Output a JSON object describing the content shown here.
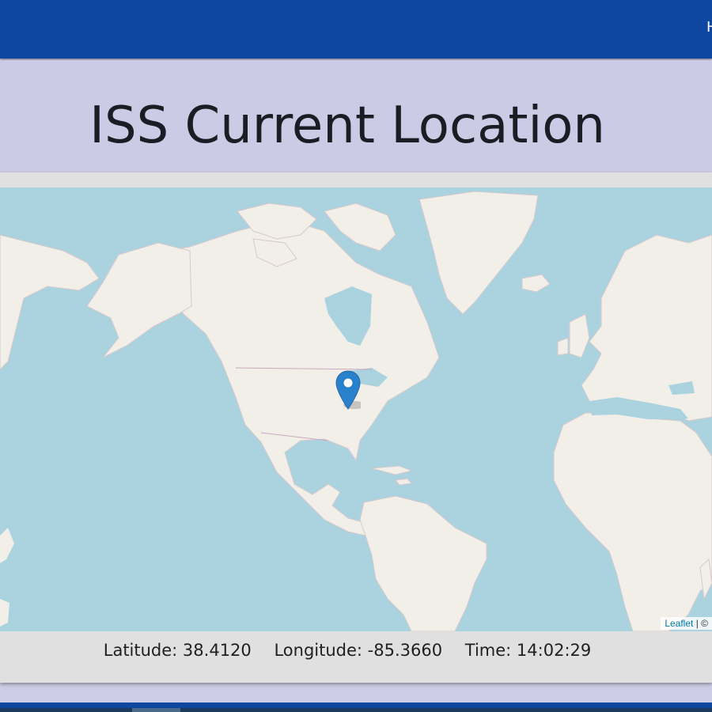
{
  "navbar": {
    "link_label": "H",
    "color": "#0d47a1"
  },
  "header": {
    "title": "ISS Current Location"
  },
  "map": {
    "attribution_link": "Leaflet",
    "attribution_rest": " | ©",
    "marker_icon": "map-pin-icon",
    "water_color": "#aad3df",
    "land_color": "#f2efe9"
  },
  "readout": {
    "latitude_label": "Latitude: 38.4120",
    "longitude_label": "Longitude: -85.3660",
    "time_label": "Time: 14:02:29",
    "latitude": 38.412,
    "longitude": -85.366,
    "time": "14:02:29"
  }
}
